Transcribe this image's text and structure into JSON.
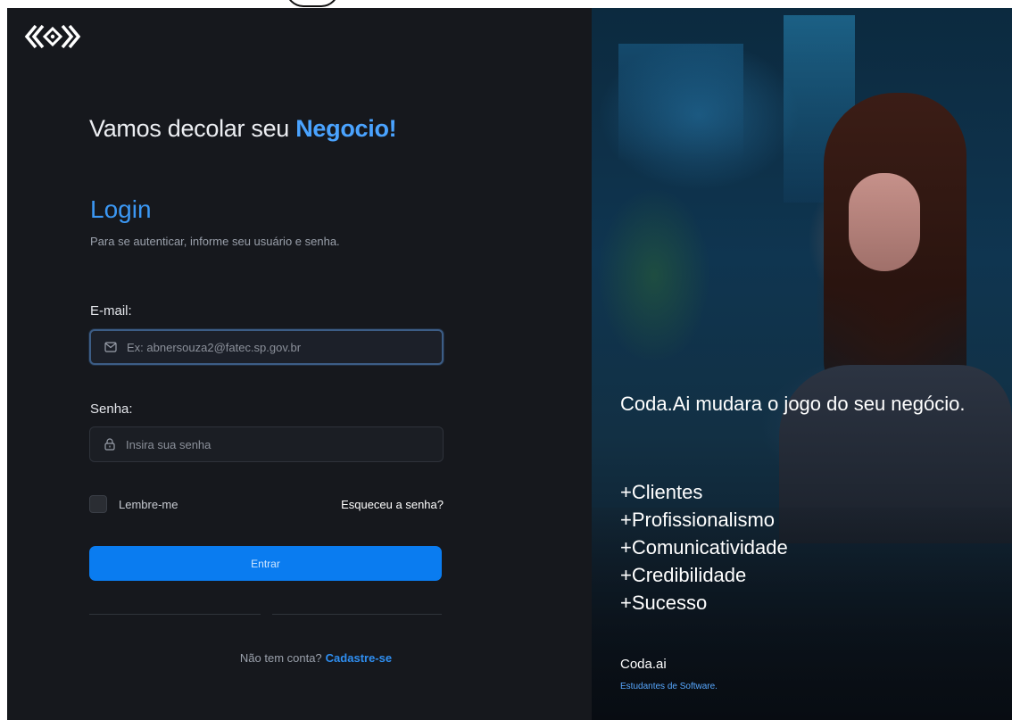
{
  "left": {
    "headline_prefix": "Vamos decolar seu ",
    "headline_accent": "Negocio!",
    "login_title": "Login",
    "login_subtitle": "Para se autenticar, informe seu usuário e senha.",
    "email": {
      "label": "E-mail:",
      "placeholder": "Ex: abnersouza2@fatec.sp.gov.br",
      "value": "",
      "icon": "mail-icon"
    },
    "password": {
      "label": "Senha:",
      "placeholder": "Insira sua senha",
      "value": "",
      "icon": "lock-icon"
    },
    "remember_label": "Lembre-me",
    "remember_checked": false,
    "forgot_label": "Esqueceu a senha?",
    "submit_label": "Entrar",
    "signup_prompt": "Não tem conta?",
    "signup_link": "Cadastre-se"
  },
  "right": {
    "promo_text": "Coda.Ai mudara o jogo do seu negócio.",
    "benefits": [
      "+Clientes",
      "+Profissionalismo",
      "+Comunicatividade",
      "+Credibilidade",
      "+Sucesso"
    ],
    "brand_name": "Coda.ai",
    "brand_tagline": "Estudantes de Software."
  },
  "colors": {
    "left_bg": "#16181d",
    "accent": "#3b97f3",
    "button": "#0a7cf0",
    "link": "#2f8ef0"
  }
}
